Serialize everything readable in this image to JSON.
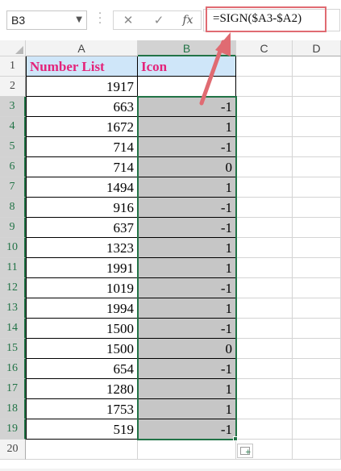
{
  "formula_bar": {
    "name_box": "B3",
    "name_box_dropdown_icon": "chevron-down-icon",
    "cancel_icon": "✕",
    "enter_icon": "✓",
    "fx_label": "fx",
    "formula": "=SIGN($A3-$A2)"
  },
  "columns": [
    "A",
    "B",
    "C",
    "D"
  ],
  "rows": [
    "1",
    "2",
    "3",
    "4",
    "5",
    "6",
    "7",
    "8",
    "9",
    "10",
    "11",
    "12",
    "13",
    "14",
    "15",
    "16",
    "17",
    "18",
    "19",
    "20"
  ],
  "header": {
    "a": "Number List",
    "b": "Icon"
  },
  "data": [
    {
      "a": "1917",
      "b": ""
    },
    {
      "a": "663",
      "b": "-1"
    },
    {
      "a": "1672",
      "b": "1"
    },
    {
      "a": "714",
      "b": "-1"
    },
    {
      "a": "714",
      "b": "0"
    },
    {
      "a": "1494",
      "b": "1"
    },
    {
      "a": "916",
      "b": "-1"
    },
    {
      "a": "637",
      "b": "-1"
    },
    {
      "a": "1323",
      "b": "1"
    },
    {
      "a": "1991",
      "b": "1"
    },
    {
      "a": "1019",
      "b": "-1"
    },
    {
      "a": "1994",
      "b": "1"
    },
    {
      "a": "1500",
      "b": "-1"
    },
    {
      "a": "1500",
      "b": "0"
    },
    {
      "a": "654",
      "b": "-1"
    },
    {
      "a": "1280",
      "b": "1"
    },
    {
      "a": "1753",
      "b": "1"
    },
    {
      "a": "519",
      "b": "-1"
    }
  ],
  "colors": {
    "header_fill": "#cfe6f9",
    "header_text": "#e4237a",
    "selection_fill": "#c6c6c6",
    "excel_green": "#217346",
    "callout": "#e06b72"
  }
}
